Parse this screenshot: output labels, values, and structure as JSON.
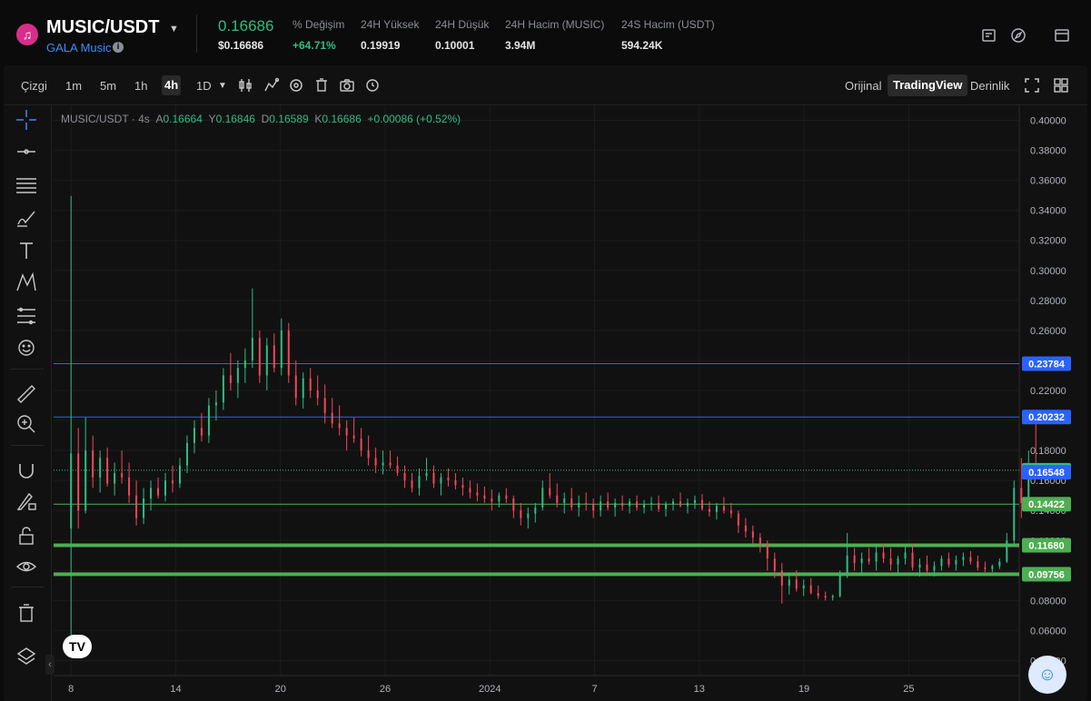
{
  "header": {
    "pair": "MUSIC/USDT",
    "subtitle": "GALA Music",
    "price": "0.16686",
    "usd_price": "$0.16686",
    "stats": [
      {
        "label": "% Değişim",
        "value": "+64.71%",
        "color": "#2ebd85"
      },
      {
        "label": "24H Yüksek",
        "value": "0.19919",
        "color": "#e6e6e6"
      },
      {
        "label": "24H Düşük",
        "value": "0.10001",
        "color": "#e6e6e6"
      },
      {
        "label": "24H Hacim (MUSIC)",
        "value": "3.94M",
        "color": "#e6e6e6"
      },
      {
        "label": "24S Hacim (USDT)",
        "value": "594.24K",
        "color": "#e6e6e6"
      }
    ],
    "icons": [
      "news-icon",
      "compass-icon",
      "layout-icon"
    ]
  },
  "toolbar": {
    "chart_type": "Çizgi",
    "intervals": [
      "1m",
      "5m",
      "1h",
      "4h",
      "1D"
    ],
    "active_interval": "4h",
    "tool_icons": [
      "candles-icon",
      "indicators-icon",
      "settings-icon",
      "delete-icon",
      "camera-icon",
      "replay-icon"
    ],
    "views": [
      "Orijinal",
      "TradingView",
      "Derinlik"
    ],
    "active_view": "TradingView",
    "right_icons": [
      "fullscreen-icon",
      "grid-layout-icon"
    ]
  },
  "tools": [
    "crosshair-icon",
    "horizontal-line-icon",
    "parallel-lines-icon",
    "brush-icon",
    "text-icon",
    "pattern-icon",
    "prediction-icon",
    "emoji-icon",
    "ruler-icon",
    "zoom-in-icon",
    "magnet-icon",
    "lock-drawing-icon",
    "unlock-icon",
    "eye-icon",
    "trash-icon",
    "layers-icon"
  ],
  "legend": {
    "symbol": "MUSIC/USDT · 4s",
    "o_label": "A",
    "o": "0.16664",
    "h_label": "Y",
    "h": "0.16846",
    "l_label": "D",
    "l": "0.16589",
    "c_label": "K",
    "c": "0.16686",
    "change": "+0.00086 (+0.52%)"
  },
  "chart_data": {
    "type": "candlestick",
    "ylim": [
      0.03,
      0.41
    ],
    "y_ticks": [
      "0.40000",
      "0.38000",
      "0.36000",
      "0.34000",
      "0.32000",
      "0.30000",
      "0.28000",
      "0.26000",
      "0.24000",
      "0.22000",
      "0.20000",
      "0.18000",
      "0.16000",
      "0.14000",
      "0.12000",
      "0.10000",
      "0.08000",
      "0.06000",
      "0.04000"
    ],
    "x_ticks": [
      {
        "label": "8",
        "index": 0
      },
      {
        "label": "14",
        "index": 36
      },
      {
        "label": "20",
        "index": 72
      },
      {
        "label": "26",
        "index": 108
      },
      {
        "label": "2024",
        "index": 144
      },
      {
        "label": "7",
        "index": 180
      },
      {
        "label": "13",
        "index": 216
      },
      {
        "label": "19",
        "index": 252
      },
      {
        "label": "25",
        "index": 288
      }
    ],
    "x_range": [
      -6,
      326
    ],
    "horizontal_lines": [
      {
        "value": 0.23784,
        "label": "0.23784",
        "color": "#2962ff",
        "width": 1,
        "style": "solid"
      },
      {
        "value": 0.20232,
        "label": "0.20232",
        "color": "#2962ff",
        "width": 1,
        "style": "solid"
      },
      {
        "value": 0.16686,
        "label": "0.16686",
        "color": "#2ebd85",
        "width": 1,
        "style": "dotted"
      },
      {
        "value": 0.16548,
        "label": "0.16548",
        "color": "#2962ff",
        "width": 1,
        "style": "none"
      },
      {
        "value": 0.14422,
        "label": "0.14422",
        "color": "#4caf50",
        "width": 1,
        "style": "solid"
      },
      {
        "value": 0.1168,
        "label": "0.11680",
        "color": "#4caf50",
        "width": 4,
        "style": "solid"
      },
      {
        "value": 0.09756,
        "label": "0.09756",
        "color": "#4caf50",
        "width": 4,
        "style": "solid"
      }
    ],
    "candles": [
      [
        0.128,
        0.34972,
        0.048,
        0.178
      ],
      [
        0.178,
        0.195,
        0.128,
        0.14
      ],
      [
        0.14,
        0.202,
        0.138,
        0.18
      ],
      [
        0.18,
        0.19,
        0.155,
        0.162
      ],
      [
        0.162,
        0.18,
        0.152,
        0.175
      ],
      [
        0.175,
        0.182,
        0.156,
        0.158
      ],
      [
        0.158,
        0.172,
        0.15,
        0.165
      ],
      [
        0.165,
        0.18,
        0.158,
        0.162
      ],
      [
        0.162,
        0.172,
        0.145,
        0.15
      ],
      [
        0.15,
        0.16,
        0.13,
        0.135
      ],
      [
        0.135,
        0.155,
        0.131,
        0.148
      ],
      [
        0.148,
        0.16,
        0.14,
        0.155
      ],
      [
        0.155,
        0.162,
        0.148,
        0.15
      ],
      [
        0.15,
        0.165,
        0.146,
        0.16
      ],
      [
        0.16,
        0.17,
        0.152,
        0.158
      ],
      [
        0.158,
        0.175,
        0.155,
        0.17
      ],
      [
        0.17,
        0.19,
        0.165,
        0.185
      ],
      [
        0.185,
        0.2,
        0.178,
        0.195
      ],
      [
        0.195,
        0.205,
        0.186,
        0.19
      ],
      [
        0.19,
        0.215,
        0.185,
        0.21
      ],
      [
        0.21,
        0.22,
        0.2,
        0.212
      ],
      [
        0.212,
        0.235,
        0.207,
        0.23
      ],
      [
        0.23,
        0.245,
        0.22,
        0.225
      ],
      [
        0.225,
        0.24,
        0.215,
        0.235
      ],
      [
        0.235,
        0.248,
        0.225,
        0.24
      ],
      [
        0.24,
        0.288,
        0.235,
        0.255
      ],
      [
        0.255,
        0.26,
        0.225,
        0.23
      ],
      [
        0.23,
        0.255,
        0.22,
        0.25
      ],
      [
        0.25,
        0.258,
        0.232,
        0.235
      ],
      [
        0.235,
        0.268,
        0.23,
        0.26
      ],
      [
        0.26,
        0.265,
        0.225,
        0.23
      ],
      [
        0.23,
        0.24,
        0.21,
        0.215
      ],
      [
        0.215,
        0.232,
        0.208,
        0.228
      ],
      [
        0.228,
        0.235,
        0.215,
        0.22
      ],
      [
        0.22,
        0.23,
        0.21,
        0.215
      ],
      [
        0.215,
        0.224,
        0.198,
        0.205
      ],
      [
        0.205,
        0.215,
        0.195,
        0.198
      ],
      [
        0.198,
        0.21,
        0.19,
        0.195
      ],
      [
        0.195,
        0.2,
        0.18,
        0.19
      ],
      [
        0.19,
        0.202,
        0.185,
        0.188
      ],
      [
        0.188,
        0.195,
        0.176,
        0.18
      ],
      [
        0.18,
        0.19,
        0.17,
        0.175
      ],
      [
        0.175,
        0.182,
        0.165,
        0.17
      ],
      [
        0.17,
        0.18,
        0.164,
        0.172
      ],
      [
        0.172,
        0.18,
        0.168,
        0.17
      ],
      [
        0.17,
        0.176,
        0.163,
        0.165
      ],
      [
        0.165,
        0.17,
        0.155,
        0.16
      ],
      [
        0.16,
        0.165,
        0.152,
        0.155
      ],
      [
        0.155,
        0.168,
        0.15,
        0.163
      ],
      [
        0.163,
        0.175,
        0.16,
        0.165
      ],
      [
        0.165,
        0.17,
        0.155,
        0.158
      ],
      [
        0.158,
        0.165,
        0.15,
        0.162
      ],
      [
        0.162,
        0.168,
        0.156,
        0.16
      ],
      [
        0.16,
        0.165,
        0.154,
        0.157
      ],
      [
        0.157,
        0.162,
        0.15,
        0.155
      ],
      [
        0.155,
        0.16,
        0.148,
        0.152
      ],
      [
        0.152,
        0.158,
        0.146,
        0.15
      ],
      [
        0.15,
        0.156,
        0.145,
        0.148
      ],
      [
        0.148,
        0.154,
        0.14,
        0.146
      ],
      [
        0.146,
        0.152,
        0.142,
        0.15
      ],
      [
        0.15,
        0.155,
        0.145,
        0.148
      ],
      [
        0.148,
        0.15,
        0.135,
        0.14
      ],
      [
        0.14,
        0.145,
        0.13,
        0.135
      ],
      [
        0.135,
        0.142,
        0.128,
        0.138
      ],
      [
        0.138,
        0.145,
        0.132,
        0.142
      ],
      [
        0.142,
        0.16,
        0.14,
        0.155
      ],
      [
        0.155,
        0.165,
        0.148,
        0.15
      ],
      [
        0.15,
        0.158,
        0.142,
        0.145
      ],
      [
        0.145,
        0.152,
        0.138,
        0.148
      ],
      [
        0.148,
        0.155,
        0.14,
        0.142
      ],
      [
        0.142,
        0.15,
        0.136,
        0.145
      ],
      [
        0.145,
        0.152,
        0.14,
        0.144
      ],
      [
        0.144,
        0.148,
        0.135,
        0.14
      ],
      [
        0.14,
        0.15,
        0.136,
        0.146
      ],
      [
        0.146,
        0.152,
        0.14,
        0.142
      ],
      [
        0.142,
        0.148,
        0.136,
        0.145
      ],
      [
        0.145,
        0.15,
        0.14,
        0.143
      ],
      [
        0.143,
        0.148,
        0.138,
        0.146
      ],
      [
        0.146,
        0.15,
        0.14,
        0.142
      ],
      [
        0.142,
        0.147,
        0.138,
        0.144
      ],
      [
        0.144,
        0.149,
        0.14,
        0.145
      ],
      [
        0.145,
        0.15,
        0.139,
        0.141
      ],
      [
        0.141,
        0.146,
        0.136,
        0.144
      ],
      [
        0.144,
        0.148,
        0.14,
        0.146
      ],
      [
        0.146,
        0.152,
        0.142,
        0.143
      ],
      [
        0.143,
        0.148,
        0.138,
        0.145
      ],
      [
        0.145,
        0.15,
        0.141,
        0.147
      ],
      [
        0.147,
        0.151,
        0.14,
        0.141
      ],
      [
        0.141,
        0.146,
        0.136,
        0.139
      ],
      [
        0.139,
        0.145,
        0.134,
        0.143
      ],
      [
        0.143,
        0.149,
        0.138,
        0.14
      ],
      [
        0.14,
        0.145,
        0.135,
        0.138
      ],
      [
        0.138,
        0.14,
        0.125,
        0.13
      ],
      [
        0.13,
        0.135,
        0.122,
        0.126
      ],
      [
        0.126,
        0.13,
        0.118,
        0.122
      ],
      [
        0.122,
        0.125,
        0.112,
        0.118
      ],
      [
        0.118,
        0.12,
        0.1,
        0.108
      ],
      [
        0.108,
        0.112,
        0.095,
        0.1
      ],
      [
        0.1,
        0.105,
        0.078,
        0.09
      ],
      [
        0.09,
        0.098,
        0.084,
        0.094
      ],
      [
        0.094,
        0.1,
        0.086,
        0.088
      ],
      [
        0.088,
        0.094,
        0.083,
        0.09
      ],
      [
        0.09,
        0.095,
        0.084,
        0.085
      ],
      [
        0.085,
        0.09,
        0.081,
        0.083
      ],
      [
        0.083,
        0.086,
        0.08,
        0.082
      ],
      [
        0.082,
        0.084,
        0.08,
        0.083
      ],
      [
        0.083,
        0.1,
        0.082,
        0.098
      ],
      [
        0.098,
        0.125,
        0.095,
        0.11
      ],
      [
        0.11,
        0.115,
        0.1,
        0.105
      ],
      [
        0.105,
        0.112,
        0.098,
        0.108
      ],
      [
        0.108,
        0.115,
        0.104,
        0.106
      ],
      [
        0.106,
        0.118,
        0.1,
        0.112
      ],
      [
        0.112,
        0.118,
        0.105,
        0.108
      ],
      [
        0.108,
        0.115,
        0.1,
        0.104
      ],
      [
        0.104,
        0.11,
        0.098,
        0.108
      ],
      [
        0.108,
        0.116,
        0.104,
        0.112
      ],
      [
        0.112,
        0.118,
        0.1,
        0.102
      ],
      [
        0.102,
        0.108,
        0.096,
        0.104
      ],
      [
        0.104,
        0.11,
        0.098,
        0.1
      ],
      [
        0.1,
        0.106,
        0.096,
        0.103
      ],
      [
        0.103,
        0.11,
        0.1,
        0.108
      ],
      [
        0.108,
        0.112,
        0.102,
        0.104
      ],
      [
        0.104,
        0.11,
        0.1,
        0.107
      ],
      [
        0.107,
        0.112,
        0.103,
        0.109
      ],
      [
        0.109,
        0.113,
        0.104,
        0.106
      ],
      [
        0.106,
        0.11,
        0.1,
        0.102
      ],
      [
        0.102,
        0.106,
        0.099,
        0.101
      ],
      [
        0.101,
        0.104,
        0.099,
        0.103
      ],
      [
        0.103,
        0.108,
        0.101,
        0.106
      ],
      [
        0.106,
        0.125,
        0.105,
        0.12
      ],
      [
        0.12,
        0.16,
        0.118,
        0.155
      ],
      [
        0.155,
        0.175,
        0.135,
        0.145
      ],
      [
        0.145,
        0.18,
        0.14,
        0.17
      ],
      [
        0.17,
        0.19919,
        0.165,
        0.16686
      ]
    ],
    "candle_x_start": 0,
    "candle_x_step": 2.9,
    "up_color": "#2ebd85",
    "down_color": "#f6465d"
  },
  "branding": {
    "tv_logo": "TV"
  },
  "avatar": {
    "name": "assistant-avatar"
  }
}
